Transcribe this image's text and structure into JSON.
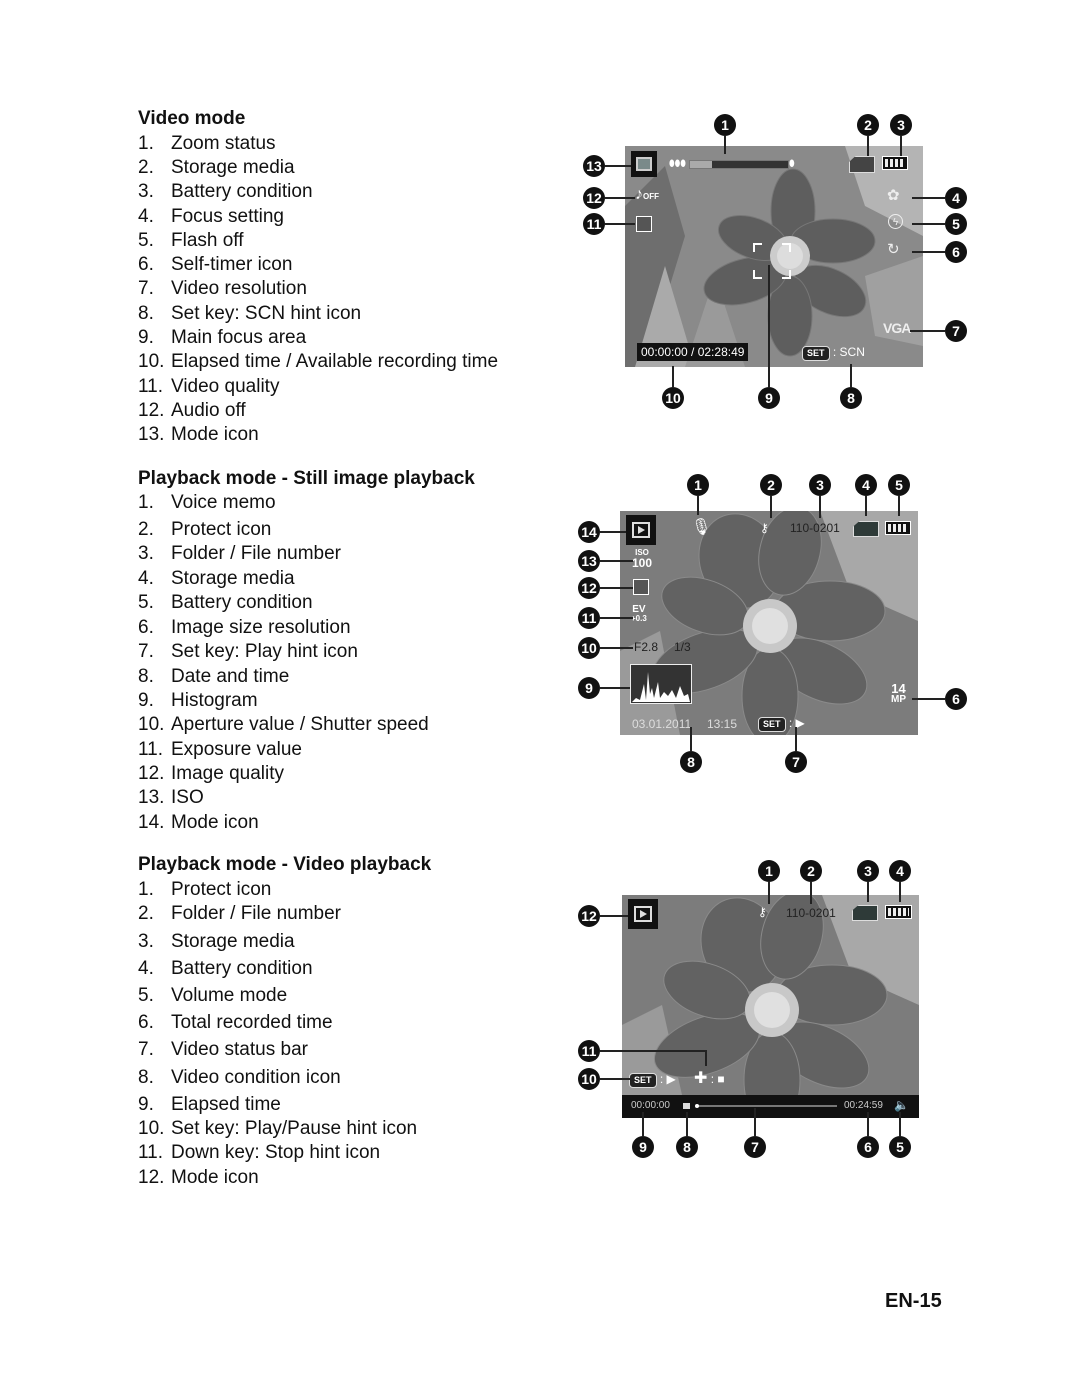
{
  "page_number": "EN-15",
  "sections": [
    {
      "title": "Video mode",
      "items": [
        {
          "num": "1.",
          "label": "Zoom status"
        },
        {
          "num": "2.",
          "label": "Storage media"
        },
        {
          "num": "3.",
          "label": "Battery condition"
        },
        {
          "num": "4.",
          "label": "Focus setting"
        },
        {
          "num": "5.",
          "label": "Flash off"
        },
        {
          "num": "6.",
          "label": "Self-timer icon"
        },
        {
          "num": "7.",
          "label": "Video resolution"
        },
        {
          "num": "8.",
          "label": "Set key: SCN hint icon"
        },
        {
          "num": "9.",
          "label": "Main focus area"
        },
        {
          "num": "10.",
          "label": "Elapsed time / Available recording time"
        },
        {
          "num": "11.",
          "label": "Video quality"
        },
        {
          "num": "12.",
          "label": "Audio off"
        },
        {
          "num": "13.",
          "label": "Mode icon"
        }
      ],
      "screen": {
        "elapsed_available": "00:00:00 / 02:28:49",
        "set_label": "SET",
        "scn_hint": ": SCN",
        "resolution": "VGA",
        "audio_off": "OFF",
        "zoom_level": 0.22,
        "callouts": [
          "1",
          "2",
          "3",
          "4",
          "5",
          "6",
          "7",
          "8",
          "9",
          "10",
          "11",
          "12",
          "13"
        ]
      }
    },
    {
      "title": "Playback mode  -  Still image playback",
      "items": [
        {
          "num": "1.",
          "label": "Voice memo"
        },
        {
          "num": "2.",
          "label": "Protect icon"
        },
        {
          "num": "3.",
          "label": "Folder / File number"
        },
        {
          "num": "4.",
          "label": "Storage media"
        },
        {
          "num": "5.",
          "label": "Battery condition"
        },
        {
          "num": "6.",
          "label": "Image size resolution"
        },
        {
          "num": "7.",
          "label": "Set key: Play hint icon"
        },
        {
          "num": "8.",
          "label": "Date and time"
        },
        {
          "num": "9.",
          "label": "Histogram"
        },
        {
          "num": "10.",
          "label": "Aperture value / Shutter speed"
        },
        {
          "num": "11.",
          "label": "Exposure value"
        },
        {
          "num": "12.",
          "label": "Image quality"
        },
        {
          "num": "13.",
          "label": "ISO"
        },
        {
          "num": "14.",
          "label": "Mode icon"
        }
      ],
      "screen": {
        "file_number": "110-0201",
        "iso_label": "ISO",
        "iso_value": "100",
        "ev_label": "EV",
        "ev_value": "+0.3",
        "aperture": "F2.8",
        "shutter": "1/3",
        "date": "03.01.2011",
        "time": "13:15",
        "set_label": "SET",
        "size_value": "14",
        "size_unit": "MP",
        "callouts": [
          "1",
          "2",
          "3",
          "4",
          "5",
          "6",
          "7",
          "8",
          "9",
          "10",
          "11",
          "12",
          "13",
          "14"
        ]
      }
    },
    {
      "title": "Playback mode  -  Video playback",
      "items": [
        {
          "num": "1.",
          "label": "Protect icon"
        },
        {
          "num": "2.",
          "label": "Folder / File number"
        },
        {
          "num": "3.",
          "label": "Storage media"
        },
        {
          "num": "4.",
          "label": "Battery condition"
        },
        {
          "num": "5.",
          "label": "Volume mode"
        },
        {
          "num": "6.",
          "label": "Total recorded time"
        },
        {
          "num": "7.",
          "label": "Video status bar"
        },
        {
          "num": "8.",
          "label": "Video condition icon"
        },
        {
          "num": "9.",
          "label": "Elapsed time"
        },
        {
          "num": "10.",
          "label": "Set key: Play/Pause hint icon"
        },
        {
          "num": "11.",
          "label": "Down key: Stop hint icon"
        },
        {
          "num": "12.",
          "label": "Mode icon"
        }
      ],
      "screen": {
        "file_number": "110-0201",
        "elapsed": "00:00:00",
        "total": "00:24:59",
        "set_label": "SET",
        "progress": 0.0,
        "callouts": [
          "1",
          "2",
          "3",
          "4",
          "5",
          "6",
          "7",
          "8",
          "9",
          "10",
          "11",
          "12"
        ]
      }
    }
  ]
}
